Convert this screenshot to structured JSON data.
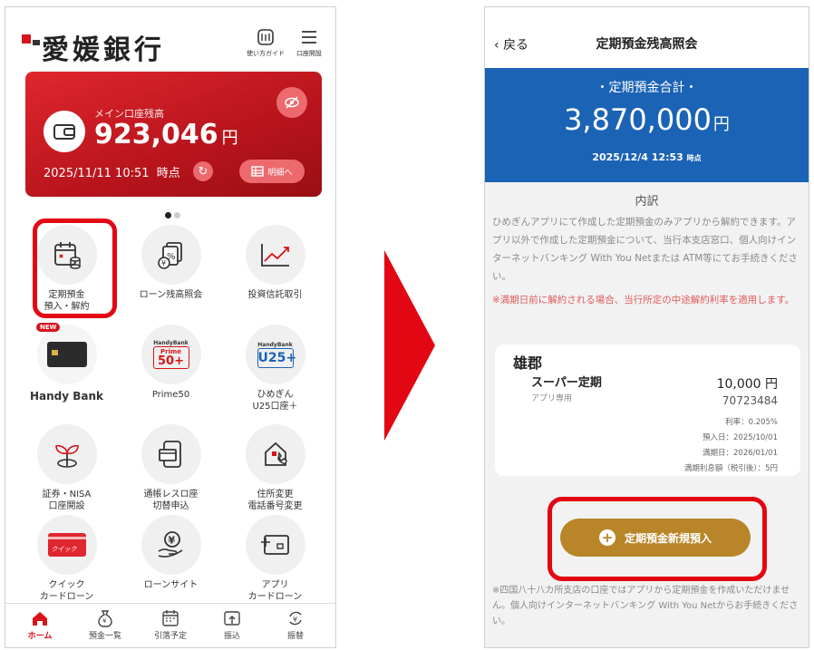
{
  "left": {
    "logo_text": "愛媛銀行",
    "header_buttons": [
      {
        "label": "使い方ガイド",
        "icon": "book-icon"
      },
      {
        "label": "口座開設",
        "icon": "menu-icon"
      }
    ],
    "balance": {
      "label": "メイン口座残高",
      "amount": "923,046",
      "currency": "円",
      "datetime": "2025/11/11 10:51",
      "time_suffix": "時点",
      "detail_label": "明細へ",
      "colors": {
        "card": "#c3161e",
        "button": "#ec6a6e"
      }
    },
    "tiles": [
      {
        "label": "定期預金\n預入・解約",
        "icon": "calendar-coins-icon"
      },
      {
        "label": "ローン残高照会",
        "icon": "yen-document-icon"
      },
      {
        "label": "投資信託取引",
        "icon": "chart-up-icon"
      },
      {
        "label": "Handy Bank",
        "icon": "handybank-card-icon",
        "badge": "NEW"
      },
      {
        "label": "Prime50",
        "icon": "prime50-icon",
        "brand": "HandyBank",
        "sub": "Prime",
        "num": "50+"
      },
      {
        "label": "ひめぎん\nU25口座＋",
        "icon": "u25-icon",
        "brand": "HandyBank",
        "num": "U25+"
      },
      {
        "label": "証券・NISA\n口座開設",
        "icon": "sprout-icon"
      },
      {
        "label": "通帳レスロ座\n切替申込",
        "icon": "passbook-icon"
      },
      {
        "label": "住所変更\n電話番号変更",
        "icon": "house-phone-icon"
      },
      {
        "label": "クイック\nカードローン",
        "icon": "quick-card-icon",
        "card_text": "クイック"
      },
      {
        "label": "ローンサイト",
        "icon": "yen-hand-icon"
      },
      {
        "label": "アプリ\nカードローン",
        "icon": "app-card-icon"
      }
    ],
    "tabs": [
      {
        "label": "ホーム",
        "icon": "home-icon",
        "active": true
      },
      {
        "label": "預金一覧",
        "icon": "money-bag-icon"
      },
      {
        "label": "引落予定",
        "icon": "calendar-icon"
      },
      {
        "label": "振込",
        "icon": "transfer-icon"
      },
      {
        "label": "振替",
        "icon": "exchange-icon"
      }
    ]
  },
  "right": {
    "back_label": "戻る",
    "title": "定期預金残高照会",
    "total_label": "・定期預金合計・",
    "total_amount": "3,870,000",
    "currency": "円",
    "datetime": "2025/12/4 12:53",
    "time_suffix": "時点",
    "breakdown_title": "内訳",
    "note_gray": "ひめぎんアプリにて作成した定期預金のみアプリから解約できます。アプリ以外で作成した定期預金について、当行本支店窓口、個人向けインターネットバンキング With You Netまたは ATM等にてお手続きください。",
    "note_red": "※満期日前に解約される場合、当行所定の中途解約利率を適用します。",
    "deposit": {
      "branch": "雄郡",
      "product": "スーパー定期",
      "sub": "アプリ専用",
      "amount": "10,000 円",
      "account": "70723484",
      "rate": "利率：0.205%",
      "deposit_date": "預入日：2025/10/01",
      "maturity_date": "満期日：2026/01/01",
      "interest": "満期利息額（税引後）：5円"
    },
    "new_deposit_label": "定期預金新規預入",
    "note_bottom": "※四国八十八カ所支店の口座ではアプリから定期預金を作成いただけません。個人向けインターネットバンキング With You Netからお手続きください。",
    "colors": {
      "header_blue": "#1b63b5",
      "button_gold": "#b88628",
      "highlight": "#e30613"
    }
  }
}
